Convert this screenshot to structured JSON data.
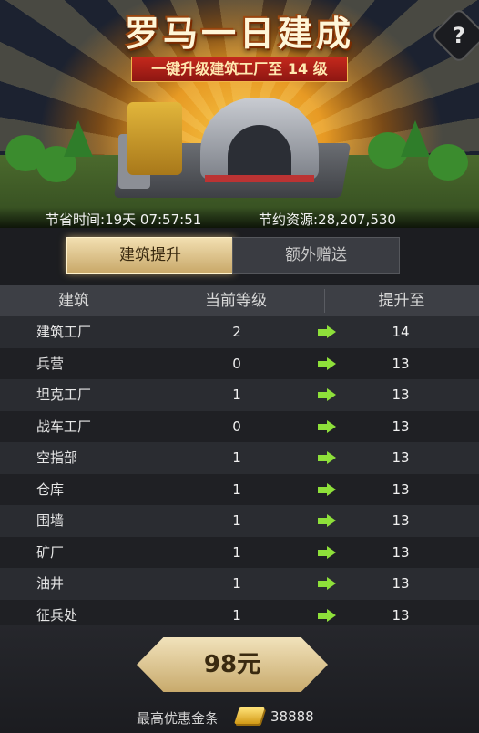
{
  "banner": {
    "title": "罗马一日建成",
    "subtitle": "一键升级建筑工厂至 14 级",
    "help_label": "?",
    "time_saved_label": "节省时间:",
    "time_saved_value": "19天 07:57:51",
    "resources_saved_label": "节约资源:",
    "resources_saved_value": "28,207,530"
  },
  "tabs": [
    {
      "label": "建筑提升",
      "active": true
    },
    {
      "label": "额外赠送",
      "active": false
    }
  ],
  "table": {
    "headers": [
      "建筑",
      "当前等级",
      "提升至"
    ],
    "rows": [
      {
        "name": "建筑工厂",
        "current": "2",
        "target": "14"
      },
      {
        "name": "兵营",
        "current": "0",
        "target": "13"
      },
      {
        "name": "坦克工厂",
        "current": "1",
        "target": "13"
      },
      {
        "name": "战车工厂",
        "current": "0",
        "target": "13"
      },
      {
        "name": "空指部",
        "current": "1",
        "target": "13"
      },
      {
        "name": "仓库",
        "current": "1",
        "target": "13"
      },
      {
        "name": "围墙",
        "current": "1",
        "target": "13"
      },
      {
        "name": "矿厂",
        "current": "1",
        "target": "13"
      },
      {
        "name": "油井",
        "current": "1",
        "target": "13"
      },
      {
        "name": "征兵处",
        "current": "1",
        "target": "13"
      }
    ]
  },
  "purchase": {
    "price_label": "98元",
    "discount_label": "最高优惠金条",
    "gold_icon": "gold-bar-icon",
    "gold_amount": "38888"
  },
  "colors": {
    "accent_gold": "#c9a96a",
    "arrow_green": "#8ee03a",
    "background": "#1c1d21"
  }
}
